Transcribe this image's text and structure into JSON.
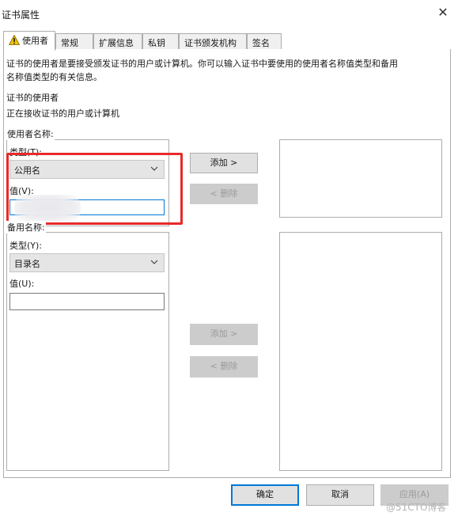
{
  "window": {
    "title": "证书属性",
    "close_glyph": "✕"
  },
  "tabs": [
    {
      "label": "使用者"
    },
    {
      "label": "常规"
    },
    {
      "label": "扩展信息"
    },
    {
      "label": "私钥"
    },
    {
      "label": "证书颁发机构"
    },
    {
      "label": "签名"
    }
  ],
  "description": {
    "line1": "证书的使用者是要接受颁发证书的用户或计算机。你可以输入证书中要使用的使用者名称值类型和备用",
    "line2": "名称值类型的有关信息。"
  },
  "subject_section": {
    "heading": "证书的使用者",
    "subtext": "正在接收证书的用户或计算机"
  },
  "subject_name": {
    "group_label": "使用者名称:",
    "type_label": "类型(T):",
    "type_value": "公用名",
    "value_label": "值(V):",
    "value_text": ""
  },
  "alt_name": {
    "group_label": "备用名称:",
    "type_label": "类型(Y):",
    "type_value": "目录名",
    "value_label": "值(U):",
    "value_text": ""
  },
  "buttons": {
    "add1": "添加 >",
    "remove1": "< 删除",
    "add2": "添加 >",
    "remove2": "< 删除",
    "ok": "确定",
    "cancel": "取消",
    "apply": "应用(A)"
  },
  "watermark": "@51CTO博客",
  "icons": {
    "tab_warning": "warning-icon",
    "dropdown": "chevron-down-icon"
  },
  "colors": {
    "highlight_box": "#e82a2a",
    "focus": "#0078d7"
  }
}
